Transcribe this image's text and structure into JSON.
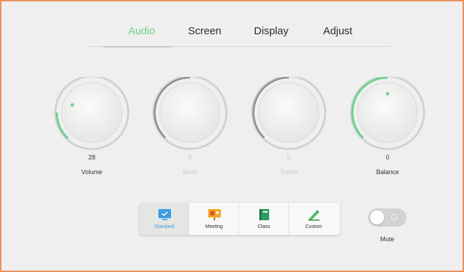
{
  "tabs": [
    {
      "label": "Audio",
      "active": true
    },
    {
      "label": "Screen",
      "active": false
    },
    {
      "label": "Display",
      "active": false
    },
    {
      "label": "Adjust",
      "active": false
    }
  ],
  "knobs": [
    {
      "label": "Volume",
      "value": "28",
      "enabled": true
    },
    {
      "label": "Bass",
      "value": "0",
      "enabled": false
    },
    {
      "label": "Treble",
      "value": "0",
      "enabled": false
    },
    {
      "label": "Balance",
      "value": "0",
      "enabled": true
    }
  ],
  "sound_modes": [
    {
      "label": "Standard",
      "icon": "standard-icon",
      "selected": true
    },
    {
      "label": "Meeting",
      "icon": "meeting-icon",
      "selected": false
    },
    {
      "label": "Class",
      "icon": "class-icon",
      "selected": false
    },
    {
      "label": "Custom",
      "icon": "custom-icon",
      "selected": false
    }
  ],
  "mute": {
    "label": "Mute",
    "on": false
  },
  "colors": {
    "accent": "#6fd18d",
    "selected_mode_text": "#3d9be0",
    "frame_border": "#e8915a",
    "background": "#eeefee"
  }
}
